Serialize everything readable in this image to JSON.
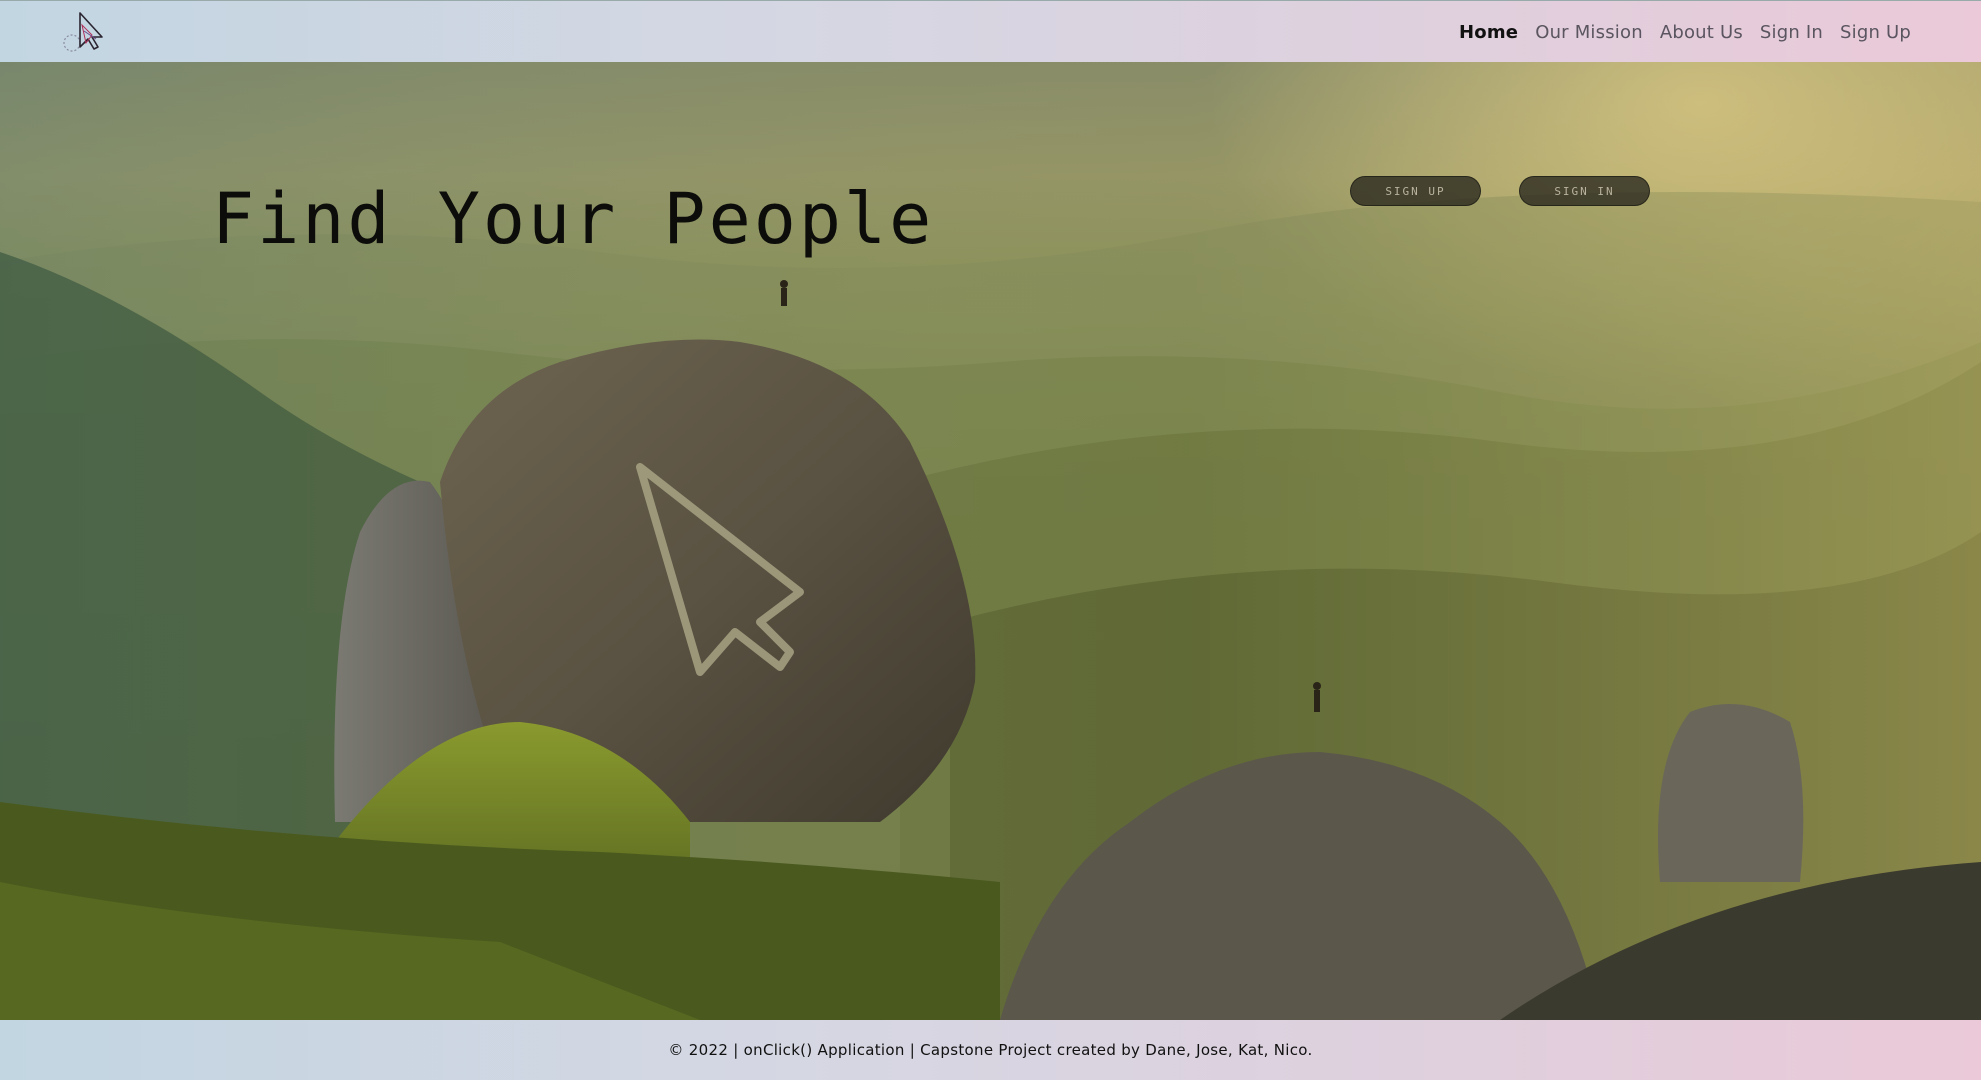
{
  "header": {
    "logo_icon": "cursor-pointer-icon",
    "nav": [
      {
        "label": "Home",
        "active": true
      },
      {
        "label": "Our Mission",
        "active": false
      },
      {
        "label": "About Us",
        "active": false
      },
      {
        "label": "Sign In",
        "active": false
      },
      {
        "label": "Sign Up",
        "active": false
      }
    ]
  },
  "hero": {
    "title": "Find Your People",
    "signup_button": "SIGN UP",
    "signin_button": "SIGN IN"
  },
  "footer": {
    "text": "© 2022 | onClick() Application | Capstone Project created by Dane, Jose, Kat, Nico."
  },
  "colors": {
    "header_gradient_start": "#c2d6e2",
    "header_gradient_end": "#ebc9d8",
    "button_bg": "#28261e",
    "active_nav": "#111111"
  }
}
